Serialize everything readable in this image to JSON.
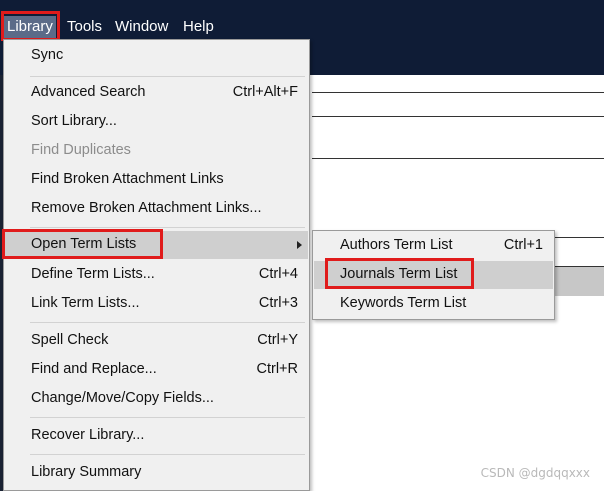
{
  "menubar": {
    "items": [
      {
        "label": "Library"
      },
      {
        "label": "Tools"
      },
      {
        "label": "Window"
      },
      {
        "label": "Help"
      }
    ]
  },
  "library_menu": {
    "items": [
      {
        "label": "Sync",
        "shortcut": ""
      },
      {
        "label": "Advanced Search",
        "shortcut": "Ctrl+Alt+F"
      },
      {
        "label": "Sort Library...",
        "shortcut": ""
      },
      {
        "label": "Find Duplicates",
        "shortcut": "",
        "disabled": true
      },
      {
        "label": "Find Broken Attachment Links",
        "shortcut": ""
      },
      {
        "label": "Remove Broken Attachment Links...",
        "shortcut": ""
      },
      {
        "label": "Open Term Lists",
        "shortcut": "",
        "submenu": true
      },
      {
        "label": "Define Term Lists...",
        "shortcut": "Ctrl+4"
      },
      {
        "label": "Link Term Lists...",
        "shortcut": "Ctrl+3"
      },
      {
        "label": "Spell Check",
        "shortcut": "Ctrl+Y"
      },
      {
        "label": "Find and Replace...",
        "shortcut": "Ctrl+R"
      },
      {
        "label": "Change/Move/Copy Fields...",
        "shortcut": ""
      },
      {
        "label": "Recover Library...",
        "shortcut": ""
      },
      {
        "label": "Library Summary",
        "shortcut": ""
      }
    ]
  },
  "term_lists_submenu": {
    "items": [
      {
        "label": "Authors Term List",
        "shortcut": "Ctrl+1"
      },
      {
        "label": "Journals Term List",
        "shortcut": ""
      },
      {
        "label": "Keywords Term List",
        "shortcut": ""
      }
    ]
  },
  "watermark": "CSDN @dgdqqxxx",
  "colors": {
    "menubar_bg": "#0f1c36",
    "menu_bg": "#f0f0f0",
    "selected_bg": "#cfcfcf",
    "highlight_box": "#e01b1b"
  }
}
